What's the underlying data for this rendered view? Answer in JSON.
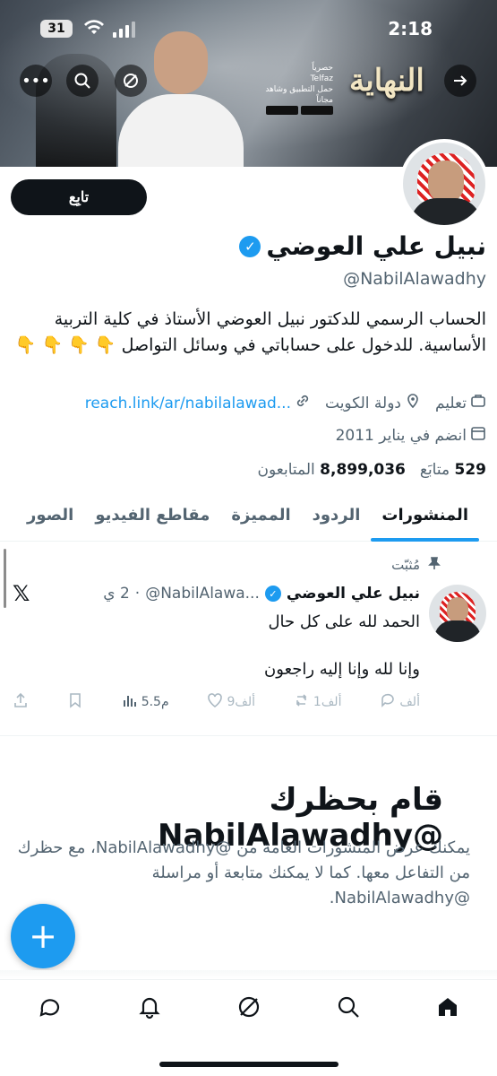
{
  "status": {
    "battery": "31",
    "time": "2:18"
  },
  "banner": {
    "logo_text": "النهاية",
    "promo_line1": "حصرياً",
    "promo_line2": "Telfaz",
    "promo_line3": "حمل التطبيق وشاهد مجاناً"
  },
  "profile": {
    "name": "نبيل علي العوضي",
    "handle": "@NabilAlawadhy",
    "follow_label": "تابِع",
    "bio": "الحساب الرسمي للدكتور نبيل العوضي الأستاذ في كلية التربية الأساسية. للدخول على حساباتي في وسائل التواصل 👇 👇 👇 👇",
    "category": "تعليم",
    "location": "دولة الكويت",
    "link": "reach.link/ar/nabilalawad...",
    "joined": "انضم في يناير 2011",
    "following_count": "529",
    "following_label": "متابَع",
    "followers_count": "8,899,036",
    "followers_label": "المتابعون"
  },
  "tabs": [
    "المنشورات",
    "الردود",
    "المميزة",
    "مقاطع الفيديو",
    "الصور"
  ],
  "pinned_post": {
    "pinned_label": "مُثبّت",
    "author": "نبيل علي العوضي",
    "handle": "@NabilAlawa...",
    "time": "2 ي",
    "line1": "الحمد لله على كل حال",
    "line2": "وإنا لله وإنا إليه راجعون",
    "replies": "ألف",
    "reposts": "1ألف",
    "likes": "9ألف",
    "views": "5.5م"
  },
  "blocked": {
    "title": "قام بحظرك @NabilAlawadhy",
    "text": "يمكنك عرض المنشورات العامة من @NabilAlawadhy، مع حظرك من التفاعل معها. كما لا يمكنك متابعة أو مراسلة @NabilAlawadhy."
  }
}
